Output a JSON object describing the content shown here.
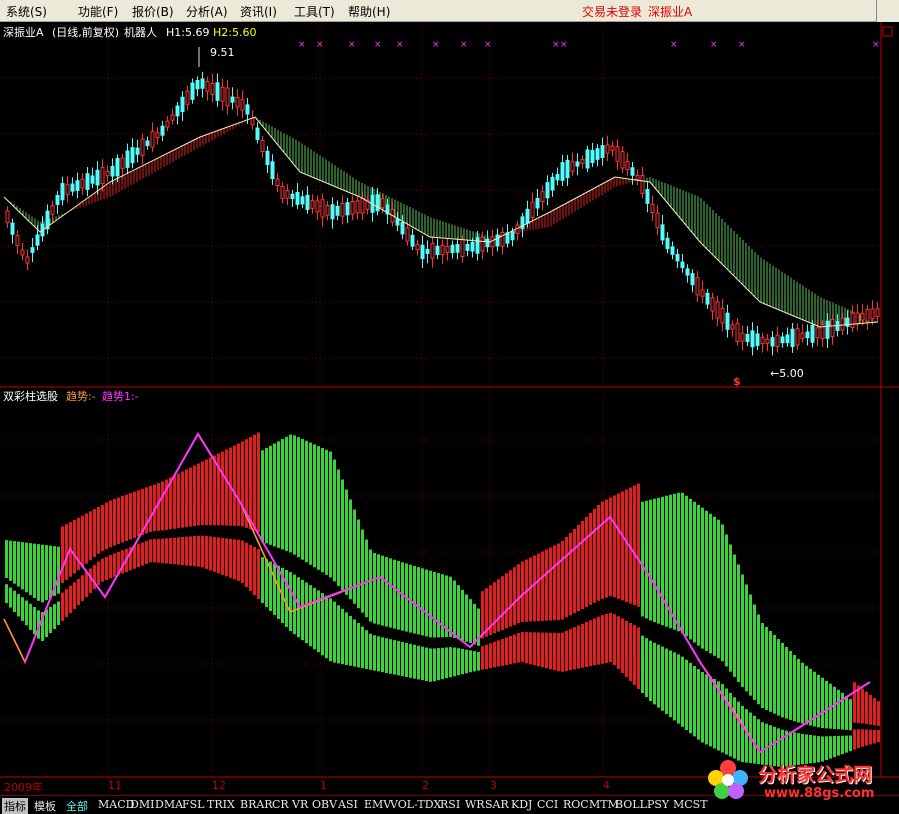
{
  "menubar": {
    "items": [
      "系统(S)",
      "功能(F)",
      "报价(B)",
      "分析(A)",
      "资讯(I)",
      "工具(T)",
      "帮助(H)"
    ],
    "login_status": "交易未登录",
    "stock_name": "深振业A"
  },
  "main_chart": {
    "title": "深振业A",
    "period": "(日线,前复权)",
    "indicator": "机器人",
    "h1_label": "H1:5.69",
    "h2_label": "H2:5.60",
    "high_price": "9.51",
    "low_price": "5.00",
    "signal_marker": "$"
  },
  "indicator_panel": {
    "name": "双彩柱选股",
    "line1_label": "趋势:-",
    "line2_label": "趋势1:-"
  },
  "x_axis": {
    "labels": [
      "2009年",
      "11",
      "12",
      "1",
      "2",
      "3",
      "4"
    ]
  },
  "bottom_tabs": [
    "指标",
    "模板",
    "全部",
    "MACD",
    "DMI",
    "DMA",
    "FSL",
    "TRIX",
    "BRAR",
    "CR",
    "VR",
    "OBV",
    "ASI",
    "EMV",
    "VOL-TDX",
    "RSI",
    "WR",
    "SAR",
    "KDJ",
    "CCI",
    "ROC",
    "MTM",
    "BOLL",
    "PSY",
    "MCST"
  ],
  "watermark": {
    "brand": "分析家公式网",
    "url": "www.88gs.com"
  },
  "colors": {
    "up": "#ff3232",
    "down": "#54fcfc",
    "green_bar": "#3cd23c",
    "red_bar": "#e02020",
    "trend": "#ff9933",
    "trend1": "#ff33ff",
    "background": "#000000",
    "grid": "#7a0000"
  }
}
